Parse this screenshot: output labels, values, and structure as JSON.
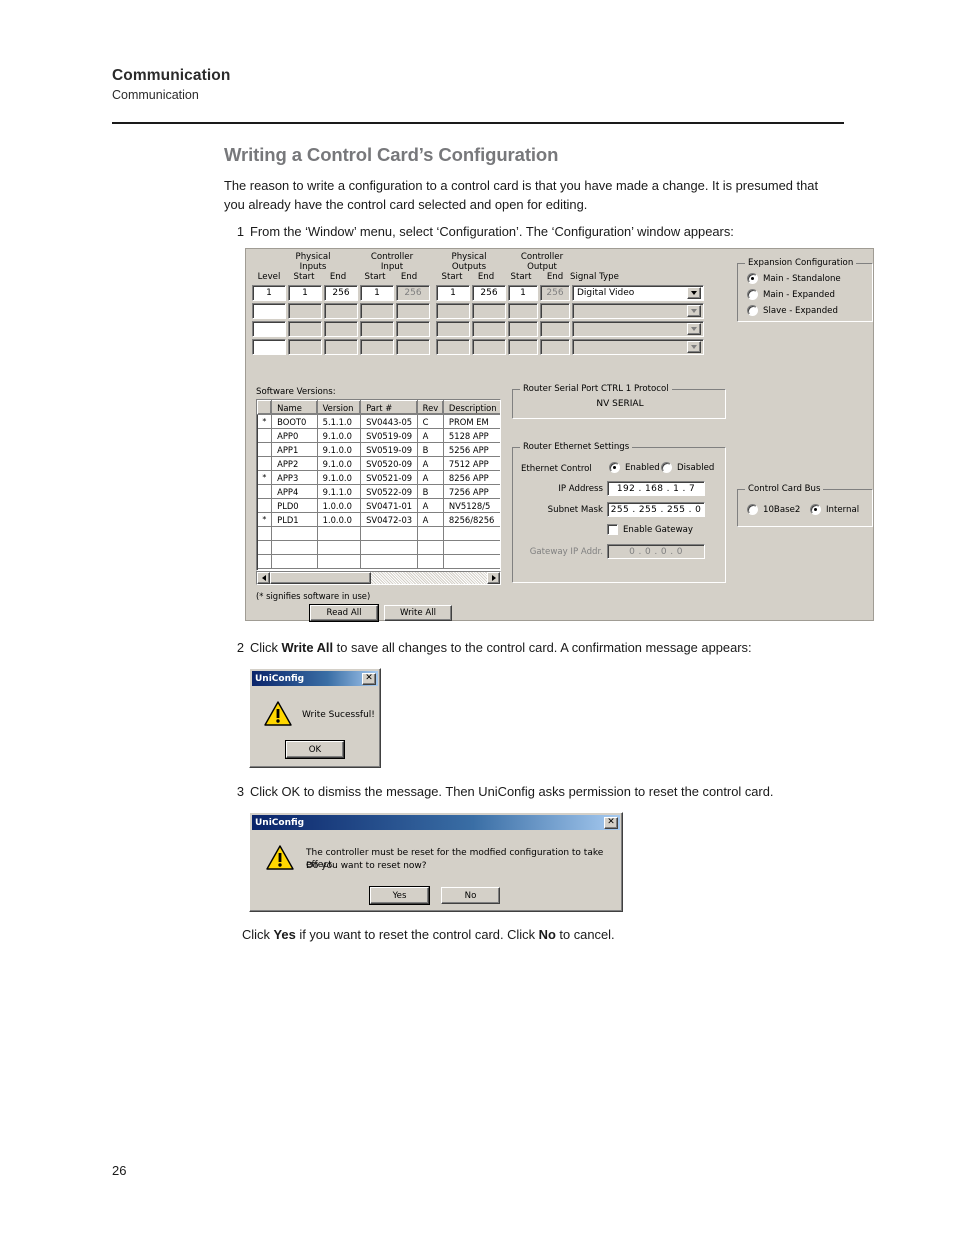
{
  "document": {
    "running_head_main": "Communication",
    "running_head_sub": "Communication",
    "page_number": "26"
  },
  "section": {
    "title": "Writing a Control Card’s Configuration",
    "intro": "The reason to write a configuration to a control card is that you have made a change. It is presumed that you already have the control card selected and open for editing."
  },
  "steps": [
    {
      "num": "1",
      "text": "From the ‘Window’ menu, select ‘Configuration’. The ‘Configuration’ window appears:"
    },
    {
      "num": "2",
      "text_pre": "Click ",
      "bold1": "Write All",
      "text_post": " to save all changes to the control card. A confirmation message appears:"
    },
    {
      "num": "3",
      "text": "Click OK to dismiss the message. Then UniConfig asks permission to reset the control card."
    }
  ],
  "closing": {
    "pre": "Click ",
    "bold1": "Yes",
    "mid": " if you want to reset the control card. Click ",
    "bold2": "No",
    "post": " to cancel."
  },
  "config_window": {
    "level_table": {
      "group_headers": [
        {
          "line1": "",
          "line2": ""
        },
        {
          "line1": "Physical",
          "line2": "Inputs"
        },
        {
          "line1": "Controller",
          "line2": "Input"
        },
        {
          "line1": "Physical",
          "line2": "Outputs"
        },
        {
          "line1": "Controller",
          "line2": "Output"
        }
      ],
      "column_headers": [
        "Level",
        "Start",
        "End",
        "Start",
        "End",
        "Start",
        "End",
        "Start",
        "End",
        "Signal Type"
      ],
      "rows": [
        {
          "level": "1",
          "phys_in_start": "1",
          "phys_in_end": "256",
          "ctrl_in_start": "1",
          "ctrl_in_end": "256",
          "phys_out_start": "1",
          "phys_out_end": "256",
          "ctrl_out_start": "1",
          "ctrl_out_end": "256",
          "signal_type": "Digital Video"
        },
        {
          "level": "",
          "phys_in_start": "",
          "phys_in_end": "",
          "ctrl_in_start": "",
          "ctrl_in_end": "",
          "phys_out_start": "",
          "phys_out_end": "",
          "ctrl_out_start": "",
          "ctrl_out_end": "",
          "signal_type": ""
        },
        {
          "level": "",
          "phys_in_start": "",
          "phys_in_end": "",
          "ctrl_in_start": "",
          "ctrl_in_end": "",
          "phys_out_start": "",
          "phys_out_end": "",
          "ctrl_out_start": "",
          "ctrl_out_end": "",
          "signal_type": ""
        },
        {
          "level": "",
          "phys_in_start": "",
          "phys_in_end": "",
          "ctrl_in_start": "",
          "ctrl_in_end": "",
          "phys_out_start": "",
          "phys_out_end": "",
          "ctrl_out_start": "",
          "ctrl_out_end": "",
          "signal_type": ""
        }
      ]
    },
    "expansion_configuration": {
      "title": "Expansion Configuration",
      "options": [
        {
          "label": "Main  - Standalone",
          "selected": true
        },
        {
          "label": "Main  - Expanded",
          "selected": false
        },
        {
          "label": "Slave - Expanded",
          "selected": false
        }
      ]
    },
    "software_versions": {
      "label": "Software Versions:",
      "columns": [
        "",
        "Name",
        "Version",
        "Part #",
        "Rev",
        "Description"
      ],
      "rows": [
        {
          "mark": "*",
          "name": "BOOT0",
          "version": "5.1.1.0",
          "part": "SV0443-05",
          "rev": "C",
          "desc": "PROM EM"
        },
        {
          "mark": "",
          "name": "APP0",
          "version": "9.1.0.0",
          "part": "SV0519-09",
          "rev": "A",
          "desc": "5128 APP"
        },
        {
          "mark": "",
          "name": "APP1",
          "version": "9.1.0.0",
          "part": "SV0519-09",
          "rev": "B",
          "desc": "5256 APP"
        },
        {
          "mark": "",
          "name": "APP2",
          "version": "9.1.0.0",
          "part": "SV0520-09",
          "rev": "A",
          "desc": "7512 APP"
        },
        {
          "mark": "*",
          "name": "APP3",
          "version": "9.1.0.0",
          "part": "SV0521-09",
          "rev": "A",
          "desc": "8256 APP"
        },
        {
          "mark": "",
          "name": "APP4",
          "version": "9.1.1.0",
          "part": "SV0522-09",
          "rev": "B",
          "desc": "7256 APP"
        },
        {
          "mark": "",
          "name": "PLD0",
          "version": "1.0.0.0",
          "part": "SV0471-01",
          "rev": "A",
          "desc": "NV5128/5"
        },
        {
          "mark": "*",
          "name": "PLD1",
          "version": "1.0.0.0",
          "part": "SV0472-03",
          "rev": "A",
          "desc": "8256/8256"
        },
        {
          "mark": "",
          "name": "",
          "version": "",
          "part": "",
          "rev": "",
          "desc": ""
        },
        {
          "mark": "",
          "name": "",
          "version": "",
          "part": "",
          "rev": "",
          "desc": ""
        },
        {
          "mark": "",
          "name": "",
          "version": "",
          "part": "",
          "rev": "",
          "desc": ""
        }
      ],
      "footnote": "(* signifies software in use)"
    },
    "router_serial_port": {
      "title": "Router Serial Port CTRL 1 Protocol",
      "value": "NV SERIAL"
    },
    "router_ethernet_settings": {
      "title": "Router Ethernet Settings",
      "ethernet_control_label": "Ethernet Control",
      "ethernet_enabled_label": "Enabled",
      "ethernet_disabled_label": "Disabled",
      "ethernet_enabled_selected": true,
      "ip_address_label": "IP Address",
      "ip_address_value": "192 . 168 .   1  .   7",
      "subnet_mask_label": "Subnet Mask",
      "subnet_mask_value": "255 . 255 . 255 .   0",
      "enable_gateway_label": "Enable Gateway",
      "enable_gateway_checked": false,
      "gateway_ip_label": "Gateway IP Addr.",
      "gateway_ip_value": "0  .  0  .  0  .  0"
    },
    "control_card_bus": {
      "title": "Control Card Bus",
      "options": [
        {
          "label": "10Base2",
          "selected": false
        },
        {
          "label": "Internal",
          "selected": true
        }
      ]
    },
    "buttons": {
      "read_all": "Read All",
      "write_all": "Write All"
    }
  },
  "dialog_write_success": {
    "title": "UniConfig",
    "close_label": "✕",
    "message": "Write Sucessful!",
    "ok_label": "OK"
  },
  "dialog_reset_confirm": {
    "title": "UniConfig",
    "close_label": "✕",
    "message_line1": "The controller must be reset for the modfied configuration to take effect.",
    "message_line2": "Do you want to reset now?",
    "yes_label": "Yes",
    "no_label": "No"
  },
  "colors": {
    "heading": "#77787b",
    "win_face": "#d4d0c8",
    "titlebar_start": "#0a246a",
    "warning_yellow": "#ffd700"
  }
}
